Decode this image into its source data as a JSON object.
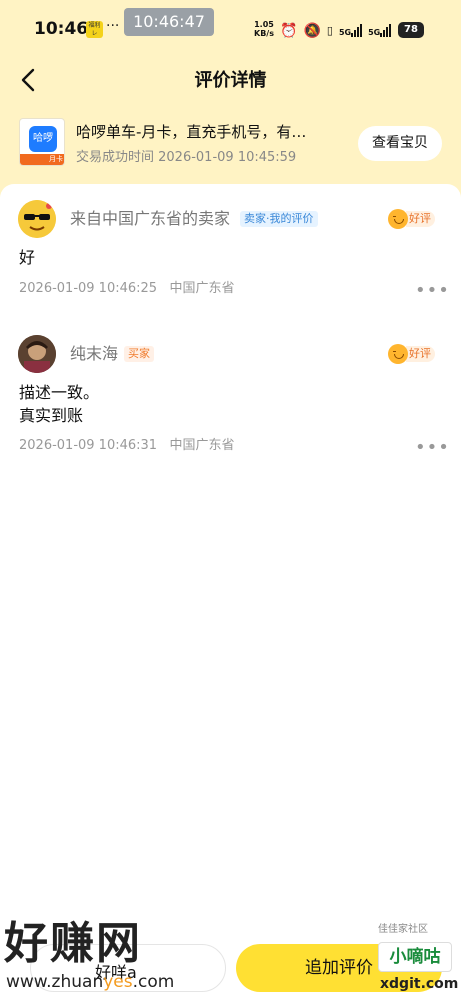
{
  "status_bar": {
    "time": "10:46",
    "badge": "福利 レ",
    "more": "···",
    "screenshot_time": "10:46:47",
    "speed_value": "1.05",
    "speed_unit": "KB/s",
    "network_1": "5G",
    "network_2": "5G",
    "battery": "78"
  },
  "header": {
    "back_icon": "chevron-left-icon",
    "title": "评价详情"
  },
  "product": {
    "thumb_text": "哈啰",
    "thumb_tag": "月卡",
    "name": "哈啰单车-月卡，直充手机号，有…",
    "trade_time": "交易成功时间 2026-01-09 10:45:59",
    "view_button": "查看宝贝"
  },
  "reviews": [
    {
      "name": "来自中国广东省的卖家",
      "role_tag": "卖家·我的评价",
      "rating": "好评",
      "text_lines": [
        "好"
      ],
      "date": "2026-01-09 10:46:25",
      "location": "中国广东省"
    },
    {
      "name": "纯末海",
      "role_tag": "买家",
      "rating": "好评",
      "text_lines": [
        "描述一致。",
        "真实到账"
      ],
      "date": "2026-01-09 10:46:31",
      "location": "中国广东省"
    }
  ],
  "bottom": {
    "left_label": "好咩a",
    "add_review_button": "追加评价"
  },
  "watermarks": {
    "left_big": "好赚网",
    "left_url_a": "www.zhuan",
    "left_url_b": "yes",
    "left_url_c": ".com",
    "right_small": "佳佳家社区",
    "right_box": "小嘀咕",
    "right_url": "xdgit.com"
  },
  "colors": {
    "top_background": "#fff3c4",
    "accent_yellow": "#ffe033",
    "rating_orange": "#e8722a"
  }
}
